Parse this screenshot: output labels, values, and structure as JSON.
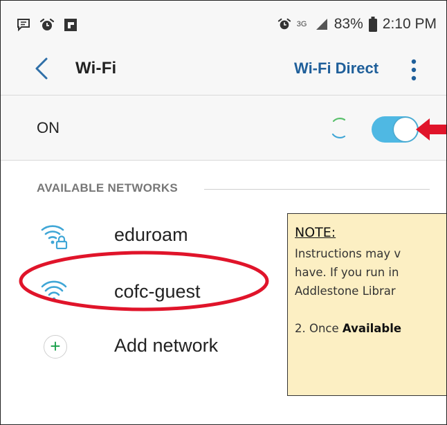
{
  "status_bar": {
    "network_type": "3G",
    "battery": "83%",
    "time": "2:10 PM",
    "icons": [
      "message-icon",
      "alarm-icon",
      "flipboard-icon",
      "alarm-icon",
      "signal-icon",
      "battery-icon"
    ]
  },
  "header": {
    "title": "Wi-Fi",
    "wifi_direct_label": "Wi-Fi Direct"
  },
  "toggle_row": {
    "label": "ON",
    "state": true,
    "accent": "#4fb8e3"
  },
  "networks": {
    "section_title": "AVAILABLE NETWORKS",
    "items": [
      {
        "name": "eduroam",
        "secured": true
      },
      {
        "name": "cofc-guest",
        "secured": false
      }
    ],
    "add_label": "Add network"
  },
  "note": {
    "heading": "NOTE:",
    "line1": "Instructions may v",
    "line2": "have. If you run in",
    "line3": "Addlestone Librar",
    "line4_prefix": "2. Once ",
    "line4_bold": "Available"
  },
  "colors": {
    "wifi_icon": "#3fa6d6",
    "link": "#1f5f9a",
    "annotation_red": "#e0142a",
    "note_bg": "#fcefc3"
  }
}
